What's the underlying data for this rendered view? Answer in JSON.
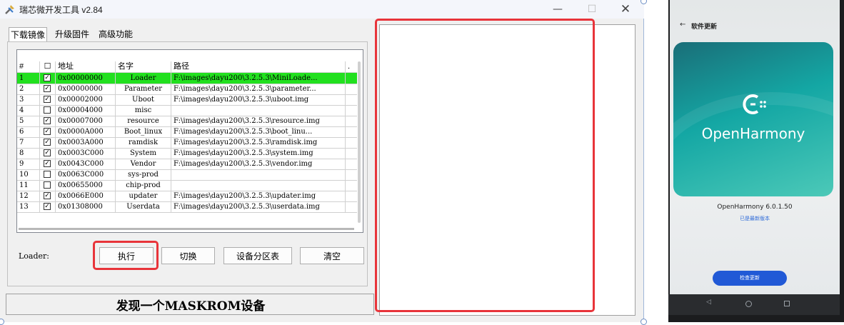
{
  "window": {
    "title": "瑞芯微开发工具 v2.84",
    "min": "—",
    "max": "☐",
    "close": "✕"
  },
  "tabs": [
    "下载镜像",
    "升级固件",
    "高级功能"
  ],
  "table": {
    "headers": {
      "num": "#",
      "chk": "☐",
      "addr": "地址",
      "name": "名字",
      "path": "路径",
      "more": "."
    },
    "rows": [
      {
        "num": "1",
        "checked": true,
        "addr": "0x00000000",
        "name": "Loader",
        "path": "F:\\images\\dayu200\\3.2.5.3\\MiniLoade..."
      },
      {
        "num": "2",
        "checked": true,
        "addr": "0x00000000",
        "name": "Parameter",
        "path": "F:\\images\\dayu200\\3.2.5.3\\parameter..."
      },
      {
        "num": "3",
        "checked": true,
        "addr": "0x00002000",
        "name": "Uboot",
        "path": "F:\\images\\dayu200\\3.2.5.3\\uboot.img"
      },
      {
        "num": "4",
        "checked": false,
        "addr": "0x00004000",
        "name": "misc",
        "path": ""
      },
      {
        "num": "5",
        "checked": true,
        "addr": "0x00007000",
        "name": "resource",
        "path": "F:\\images\\dayu200\\3.2.5.3\\resource.img"
      },
      {
        "num": "6",
        "checked": true,
        "addr": "0x0000A000",
        "name": "Boot_linux",
        "path": "F:\\images\\dayu200\\3.2.5.3\\boot_linu..."
      },
      {
        "num": "7",
        "checked": true,
        "addr": "0x0003A000",
        "name": "ramdisk",
        "path": "F:\\images\\dayu200\\3.2.5.3\\ramdisk.img"
      },
      {
        "num": "8",
        "checked": true,
        "addr": "0x0003C000",
        "name": "System",
        "path": "F:\\images\\dayu200\\3.2.5.3\\system.img"
      },
      {
        "num": "9",
        "checked": true,
        "addr": "0x0043C000",
        "name": "Vendor",
        "path": "F:\\images\\dayu200\\3.2.5.3\\vendor.img"
      },
      {
        "num": "10",
        "checked": false,
        "addr": "0x0063C000",
        "name": "sys-prod",
        "path": ""
      },
      {
        "num": "11",
        "checked": false,
        "addr": "0x00655000",
        "name": "chip-prod",
        "path": ""
      },
      {
        "num": "12",
        "checked": true,
        "addr": "0x0066E000",
        "name": "updater",
        "path": "F:\\images\\dayu200\\3.2.5.3\\updater.img"
      },
      {
        "num": "13",
        "checked": true,
        "addr": "0x01308000",
        "name": "Userdata",
        "path": "F:\\images\\dayu200\\3.2.5.3\\userdata.img"
      }
    ],
    "selected_row": 0
  },
  "loader_label": "Loader:",
  "buttons": {
    "exec": "执行",
    "switch": "切换",
    "partition": "设备分区表",
    "clear": "清空"
  },
  "status": "发现一个MASKROM设备",
  "colors": {
    "selected_row": "#22e01f",
    "highlight": "#e8343a",
    "phone_button": "#2159d6"
  },
  "phone": {
    "screen_title": "软件更新",
    "brand": "OpenHarmony",
    "version": "OpenHarmony 6.0.1.50",
    "latest": "已是最新版本",
    "check_button": "检查更新",
    "icons": [
      "back-arrow-icon",
      "openharmony-logo-icon",
      "nav-back-icon",
      "nav-home-icon",
      "nav-recent-icon"
    ]
  }
}
